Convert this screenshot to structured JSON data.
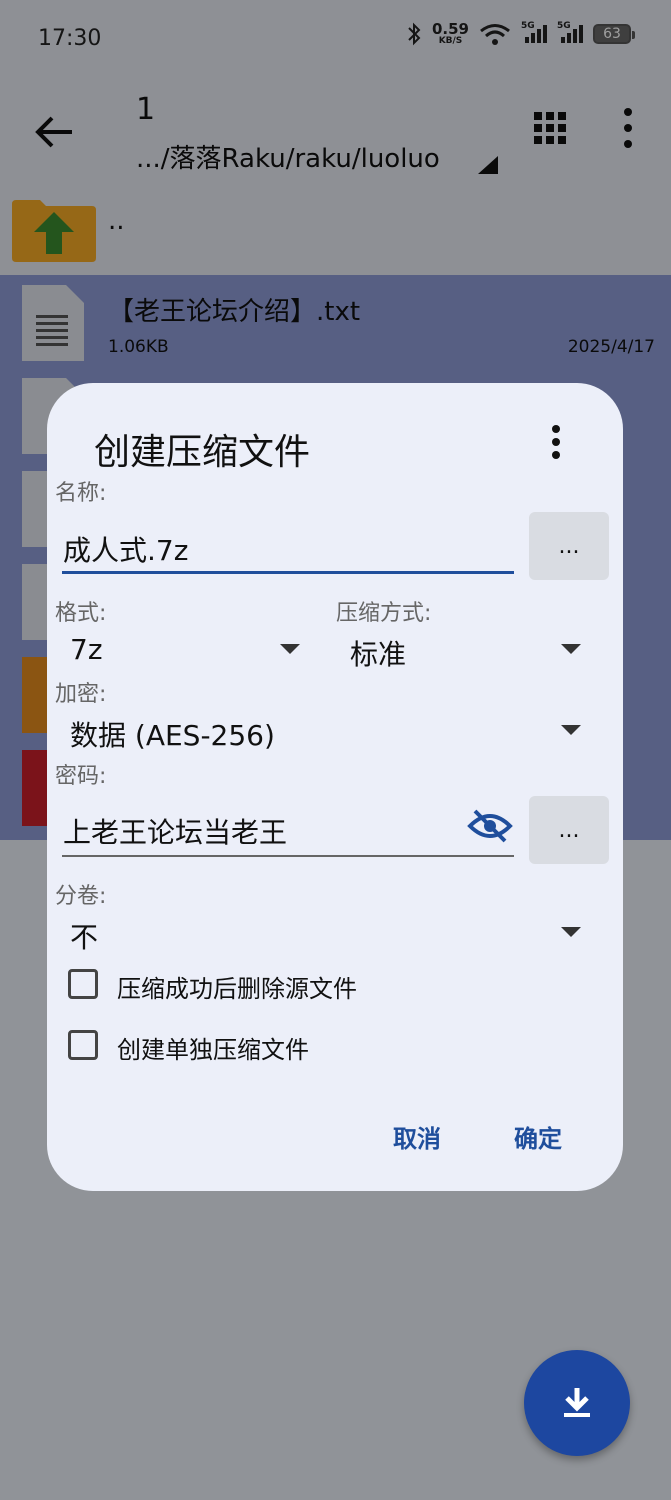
{
  "status": {
    "time": "17:30",
    "speed_value": "0.59",
    "speed_unit": "KB/S",
    "net_label": "5G",
    "battery": "63"
  },
  "toolbar": {
    "title": "1",
    "path": ".../落落Raku/raku/luoluo",
    "back_icon": "back-arrow-icon",
    "view_icon": "grid-view-icon",
    "more_icon": "more-vert-icon"
  },
  "files": {
    "parent": "..",
    "items": [
      {
        "name": "【老王论坛介绍】.txt",
        "size": "1.06KB",
        "date": "2025/4/17"
      }
    ]
  },
  "dialog": {
    "title": "创建压缩文件",
    "name_label": "名称:",
    "name_value": "成人式.7z",
    "browse_label": "...",
    "format_label": "格式:",
    "format_value": "7z",
    "method_label": "压缩方式:",
    "method_value": "标准",
    "encrypt_label": "加密:",
    "encrypt_value": "数据 (AES-256)",
    "password_label": "密码:",
    "password_value": "上老王论坛当老王",
    "volume_label": "分卷:",
    "volume_value": "不",
    "checkbox_delete": "压缩成功后删除源文件",
    "checkbox_separate": "创建单独压缩文件",
    "cancel": "取消",
    "ok": "确定"
  },
  "colors": {
    "accent": "#1d47a0",
    "selection": "#8d9ad4",
    "dialog_bg": "#eceff9"
  }
}
